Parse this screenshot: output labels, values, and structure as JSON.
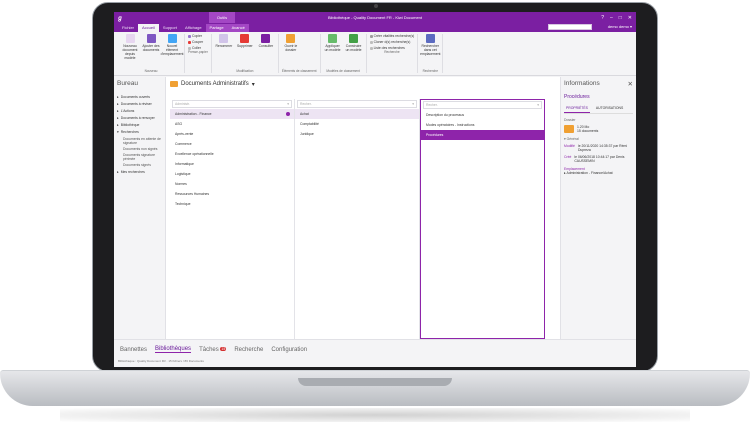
{
  "titlebar": {
    "context_tab": "Outils",
    "title": "Bibliothèque - Quality Document FR - Kiwi Document",
    "win_buttons": [
      "?",
      "–",
      "□",
      "✕"
    ]
  },
  "tabs": {
    "items": [
      "Fichier",
      "Accueil",
      "Support",
      "Affichage"
    ],
    "context_items": [
      "Partage",
      "Avancé"
    ],
    "user": "demo demo ▾"
  },
  "ribbon": {
    "groups": [
      {
        "label": "Nouveau",
        "buttons": [
          {
            "label": "Nouveau document depuis modèle",
            "color": "#e7d6f0"
          },
          {
            "label": "Ajouter des documents",
            "color": "#7e57c2"
          },
          {
            "label": "Nouvel élément d'emplacement",
            "color": "#42a5f5"
          }
        ]
      },
      {
        "label": "Presse-papier",
        "small": [
          {
            "label": "Copier",
            "color": "#9575cd"
          },
          {
            "label": "Couper",
            "color": "#e53935"
          },
          {
            "label": "Coller",
            "color": "#bdbdbd"
          }
        ]
      },
      {
        "label": "Modification",
        "buttons": [
          {
            "label": "Renommer",
            "color": "#d1c4e9"
          },
          {
            "label": "Supprimer",
            "color": "#e53935"
          },
          {
            "label": "Consulter",
            "color": "#7b1fa2"
          }
        ]
      },
      {
        "label": "Éléments de classement",
        "buttons": [
          {
            "label": "Ouvrir le dossier",
            "color": "#f0a033"
          }
        ]
      },
      {
        "label": "Modèles de classement",
        "buttons": [
          {
            "label": "Appliquer un modèle",
            "color": "#66bb6a"
          },
          {
            "label": "Construire un modèle",
            "color": "#43a047"
          }
        ]
      },
      {
        "label": "Recherche",
        "small": [
          {
            "label": "Créer vitalités recherche(s)",
            "color": "#9e9e9e"
          },
          {
            "label": "Cloner d(s) recherche(s)",
            "color": "#bdbdbd"
          },
          {
            "label": "Liste des recherches",
            "color": "#bdbdbd"
          }
        ]
      },
      {
        "label": "Recherche",
        "buttons": [
          {
            "label": "Rechercher dans cet emplacement",
            "color": "#5c6bc0"
          }
        ]
      }
    ]
  },
  "sidebar": {
    "title": "Bureau",
    "items": [
      {
        "label": "Documents ouverts"
      },
      {
        "label": "Documents à réviser"
      },
      {
        "label": "L'Actions"
      },
      {
        "label": "Documents à renvoyer"
      },
      {
        "label": "Bibliothèque"
      },
      {
        "label": "Recherches"
      }
    ],
    "subitems": [
      "Documents en attente de signature",
      "Documents non signés",
      "Documents signature périmée",
      "Documents signés"
    ],
    "last": "Mes recherches"
  },
  "breadcrumb": {
    "title": "Documents Administratifs"
  },
  "columns": [
    {
      "placeholder": "Administr.",
      "rows": [
        "Administration - Finance",
        "ASG",
        "Après-vente",
        "Commerce",
        "Excellence opérationnelle",
        "Informatique",
        "Logistique",
        "Normes",
        "Ressources Humaines",
        "Technique"
      ],
      "selected": 0
    },
    {
      "placeholder": "Recher.",
      "rows": [
        "Achat",
        "Comptabilité",
        "Juridique"
      ],
      "selected": 0
    },
    {
      "placeholder": "Recher.",
      "rows": [
        "Description du processus",
        "Modes opératoires - Instructions",
        "Procédures"
      ],
      "active": 2
    }
  ],
  "info": {
    "title": "Informations",
    "subtitle": "Procédures",
    "tabs": [
      "PROPRIÉTÉS",
      "AUTORISATIONS"
    ],
    "dossier_label": "Dossier",
    "size": "1.20 Mo",
    "count": "15 documents",
    "section": "▾ Général",
    "created_label": "Modifié",
    "created": "le 20/11/2020 14:35:37 par Rémi Dupreza",
    "created_by": "",
    "modified_label": "Créé",
    "modified": "le 06/06/2018 10:44:17 par Denis CAUSSEMIN",
    "location_label": "Emplacement",
    "location": "▸ Administration - Finance\\Achat"
  },
  "bottom_tabs": [
    "Bannettes",
    "Bibliothèques",
    "Tâches",
    "Recherche",
    "Configuration"
  ],
  "tasks_badge": "15",
  "status": "Bibliothèque : Quality Document FR · 15 fichiers / 86 Documents"
}
